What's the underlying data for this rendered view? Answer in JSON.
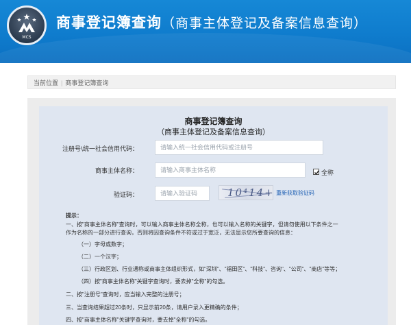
{
  "header": {
    "title": "商事登记簿查询",
    "subtitle": "（商事主体登记及备案信息查询）",
    "logo_text": "MCS"
  },
  "breadcrumb": {
    "label": "当前位置",
    "current": "商事登记簿查询"
  },
  "form": {
    "title": "商事登记簿查询",
    "subtitle": "（商事主体登记及备案信息查询）",
    "fields": {
      "reg_no_label": "注册号\\统一社会信用代码：",
      "reg_no_placeholder": "请输入统一社会信用代码或注册号",
      "name_label": "商事主体名称：",
      "name_placeholder": "请输入商事主体名称",
      "fullname_checkbox_label": "全称",
      "fullname_checked": true,
      "captcha_label": "验证码：",
      "captcha_placeholder": "请输入验证码",
      "captcha_image_text": "10⁴14+7",
      "refresh_link": "重新获取验证码"
    }
  },
  "tips": {
    "heading": "提示：",
    "lines": [
      "一、按\"商事主体名称\"查询时，可以输入商事主体名称全称，也可以输入名称的关键字，但请勿使用以下条件之一",
      "作为名称的一部分进行查询，否则将因查询条件不符或过于宽泛，无法显示您所要查询的信息：",
      "（一）字母或数字；",
      "（二）一个汉字；",
      "（三）行政区划、行业通称或商事主体组织形式，如\"深圳\"、\"福田区\"、\"科技\"、咨询\"、\"公司\"、\"商店\"等等；",
      "（四）按\"商事主体名称\"关键字查询时，要去掉\"全称\"的勾选。",
      "二、按\"注册号\"查询时，应当输入完整的注册号；",
      "三、当查询结果超过20条时，只显示前20条，请用户录入更精确的条件；",
      "四、按\"商事主体名称\"关键字查询时，要去掉\"全称\"的勾选。"
    ]
  },
  "colors": {
    "banner": "#0f7ccd",
    "panel": "#dfe6f1",
    "link": "#1d5fb3"
  }
}
